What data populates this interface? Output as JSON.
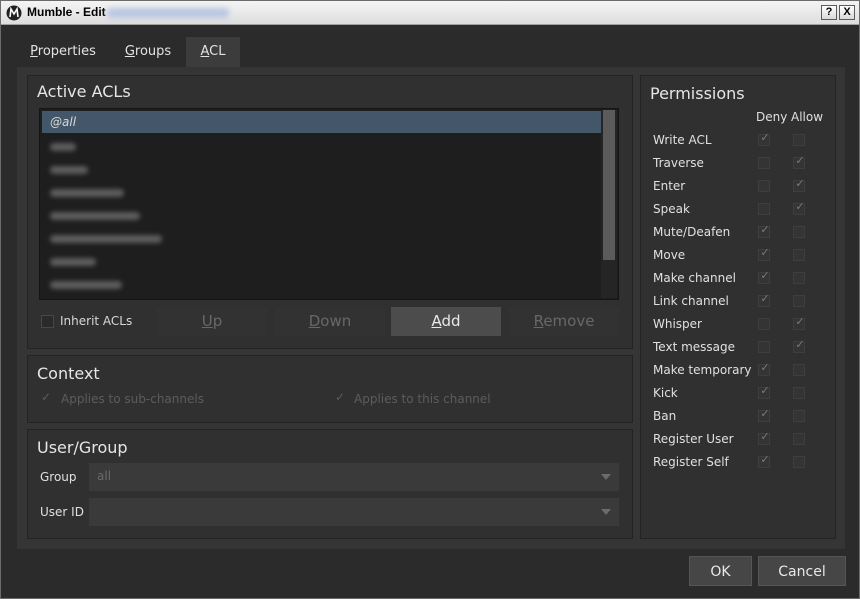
{
  "window": {
    "title": "Mumble - Edit",
    "help_label": "?",
    "close_label": "X"
  },
  "tabs": [
    {
      "label_pre": "",
      "label_u": "P",
      "label_post": "roperties"
    },
    {
      "label_pre": "",
      "label_u": "G",
      "label_post": "roups"
    },
    {
      "label_pre": "",
      "label_u": "A",
      "label_post": "CL"
    }
  ],
  "active_acls": {
    "title": "Active ACLs",
    "items": [
      "@all"
    ],
    "inherit_label": "Inherit ACLs",
    "buttons": {
      "up_u": "U",
      "up_rest": "p",
      "down_u": "D",
      "down_rest": "own",
      "add_u": "A",
      "add_rest": "dd",
      "remove_u": "R",
      "remove_rest": "emove"
    }
  },
  "context": {
    "title": "Context",
    "subchannels": "Applies to sub-channels",
    "this_channel": "Applies to this channel"
  },
  "user_group": {
    "title": "User/Group",
    "group_label": "Group",
    "group_value": "all",
    "userid_label": "User ID",
    "userid_value": ""
  },
  "permissions": {
    "title": "Permissions",
    "deny_header": "Deny",
    "allow_header": "Allow",
    "rows": [
      {
        "label": "Write ACL",
        "deny": true,
        "allow": false
      },
      {
        "label": "Traverse",
        "deny": false,
        "allow": true
      },
      {
        "label": "Enter",
        "deny": false,
        "allow": true
      },
      {
        "label": "Speak",
        "deny": false,
        "allow": true
      },
      {
        "label": "Mute/Deafen",
        "deny": true,
        "allow": false
      },
      {
        "label": "Move",
        "deny": true,
        "allow": false
      },
      {
        "label": "Make channel",
        "deny": true,
        "allow": false
      },
      {
        "label": "Link channel",
        "deny": true,
        "allow": false
      },
      {
        "label": "Whisper",
        "deny": false,
        "allow": true
      },
      {
        "label": "Text message",
        "deny": false,
        "allow": true
      },
      {
        "label": "Make temporary",
        "deny": true,
        "allow": false
      },
      {
        "label": "Kick",
        "deny": true,
        "allow": false
      },
      {
        "label": "Ban",
        "deny": true,
        "allow": false
      },
      {
        "label": "Register User",
        "deny": true,
        "allow": false
      },
      {
        "label": "Register Self",
        "deny": true,
        "allow": false
      }
    ]
  },
  "dialog": {
    "ok_label": "OK",
    "cancel_label": "Cancel"
  },
  "icons": {
    "app": "mumble-icon",
    "check": "✓"
  }
}
